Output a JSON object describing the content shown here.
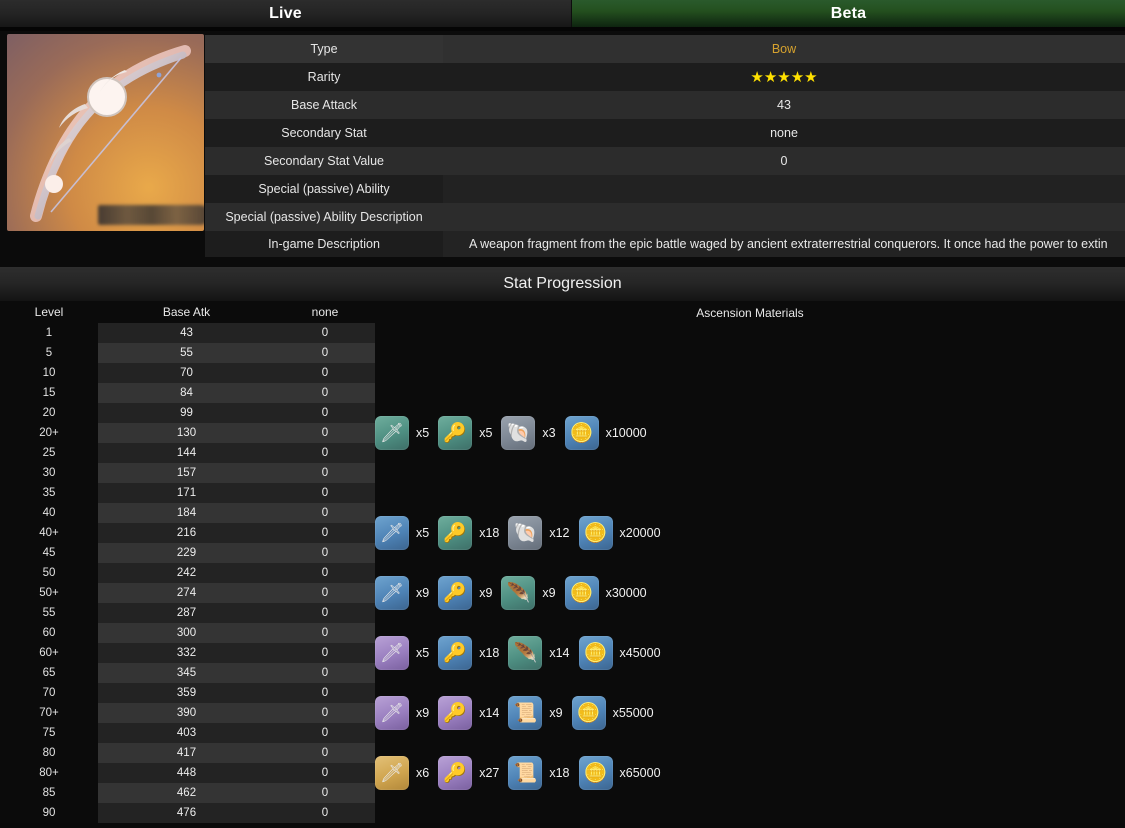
{
  "tabs": [
    {
      "label": "Live",
      "active": false
    },
    {
      "label": "Beta",
      "active": true
    }
  ],
  "weapon": {
    "thumbnail_alt": "bow-weapon-artwork",
    "name_label_blurred": ""
  },
  "info": {
    "rows": [
      {
        "key": "Type",
        "value": "Bow",
        "style": "type"
      },
      {
        "key": "Rarity",
        "value": "★★★★★",
        "style": "stars"
      },
      {
        "key": "Base Attack",
        "value": "43",
        "style": "plain"
      },
      {
        "key": "Secondary Stat",
        "value": "none",
        "style": "plain"
      },
      {
        "key": "Secondary Stat Value",
        "value": "0",
        "style": "plain"
      },
      {
        "key": "Special (passive) Ability",
        "value": "",
        "style": "plain"
      },
      {
        "key": "Special (passive) Ability Description",
        "value": "",
        "style": "plain"
      },
      {
        "key": "In-game Description",
        "value": "A weapon fragment from the epic battle waged by ancient extraterrestrial conquerors. It once had the power to extin",
        "style": "desc"
      }
    ]
  },
  "stat_progression": {
    "title": "Stat Progression",
    "columns": [
      "Level",
      "Base Atk",
      "none",
      "Ascension Materials"
    ],
    "rows": [
      {
        "level": "1",
        "atk": "43",
        "sec": "0",
        "materials": []
      },
      {
        "level": "5",
        "atk": "55",
        "sec": "0",
        "materials": []
      },
      {
        "level": "10",
        "atk": "70",
        "sec": "0",
        "materials": []
      },
      {
        "level": "15",
        "atk": "84",
        "sec": "0",
        "materials": []
      },
      {
        "level": "20",
        "atk": "99",
        "sec": "0",
        "materials": []
      },
      {
        "level": "20+",
        "atk": "130",
        "sec": "0",
        "materials": [
          {
            "icon": "weapon-ascension-fragment-icon",
            "tile": "teal",
            "glyph": "🗡",
            "count": "x5"
          },
          {
            "icon": "weapon-enhancement-ore-icon",
            "tile": "teal",
            "glyph": "🔑",
            "count": "x5"
          },
          {
            "icon": "monster-drop-shell-icon",
            "tile": "grayb",
            "glyph": "🐚",
            "count": "x3"
          },
          {
            "icon": "mora-coin-icon",
            "tile": "blue",
            "glyph": "🪙",
            "count": "x10000"
          }
        ]
      },
      {
        "level": "25",
        "atk": "144",
        "sec": "0",
        "materials": []
      },
      {
        "level": "30",
        "atk": "157",
        "sec": "0",
        "materials": []
      },
      {
        "level": "35",
        "atk": "171",
        "sec": "0",
        "materials": []
      },
      {
        "level": "40",
        "atk": "184",
        "sec": "0",
        "materials": []
      },
      {
        "level": "40+",
        "atk": "216",
        "sec": "0",
        "materials": [
          {
            "icon": "weapon-ascension-fragment-icon",
            "tile": "blue",
            "glyph": "🗡",
            "count": "x5"
          },
          {
            "icon": "weapon-enhancement-ore-icon",
            "tile": "teal",
            "glyph": "🔑",
            "count": "x18"
          },
          {
            "icon": "monster-drop-shell-icon",
            "tile": "grayb",
            "glyph": "🐚",
            "count": "x12"
          },
          {
            "icon": "mora-coin-icon",
            "tile": "blue",
            "glyph": "🪙",
            "count": "x20000"
          }
        ]
      },
      {
        "level": "45",
        "atk": "229",
        "sec": "0",
        "materials": []
      },
      {
        "level": "50",
        "atk": "242",
        "sec": "0",
        "materials": []
      },
      {
        "level": "50+",
        "atk": "274",
        "sec": "0",
        "materials": [
          {
            "icon": "weapon-ascension-fragment-icon",
            "tile": "blue",
            "glyph": "🗡",
            "count": "x9"
          },
          {
            "icon": "weapon-enhancement-ore-icon",
            "tile": "blue",
            "glyph": "🔑",
            "count": "x9"
          },
          {
            "icon": "monster-drop-feather-icon",
            "tile": "teal",
            "glyph": "🪶",
            "count": "x9"
          },
          {
            "icon": "mora-coin-icon",
            "tile": "blue",
            "glyph": "🪙",
            "count": "x30000"
          }
        ]
      },
      {
        "level": "55",
        "atk": "287",
        "sec": "0",
        "materials": []
      },
      {
        "level": "60",
        "atk": "300",
        "sec": "0",
        "materials": []
      },
      {
        "level": "60+",
        "atk": "332",
        "sec": "0",
        "materials": [
          {
            "icon": "weapon-ascension-fragment-icon",
            "tile": "violet",
            "glyph": "🗡",
            "count": "x5"
          },
          {
            "icon": "weapon-enhancement-ore-icon",
            "tile": "blue",
            "glyph": "🔑",
            "count": "x18"
          },
          {
            "icon": "monster-drop-feather-icon",
            "tile": "teal",
            "glyph": "🪶",
            "count": "x14"
          },
          {
            "icon": "mora-coin-icon",
            "tile": "blue",
            "glyph": "🪙",
            "count": "x45000"
          }
        ]
      },
      {
        "level": "65",
        "atk": "345",
        "sec": "0",
        "materials": []
      },
      {
        "level": "70",
        "atk": "359",
        "sec": "0",
        "materials": []
      },
      {
        "level": "70+",
        "atk": "390",
        "sec": "0",
        "materials": [
          {
            "icon": "weapon-ascension-fragment-icon",
            "tile": "violet",
            "glyph": "🗡",
            "count": "x9"
          },
          {
            "icon": "weapon-enhancement-ore-icon",
            "tile": "violet",
            "glyph": "🔑",
            "count": "x14"
          },
          {
            "icon": "monster-drop-scroll-icon",
            "tile": "blue",
            "glyph": "📜",
            "count": "x9"
          },
          {
            "icon": "mora-coin-icon",
            "tile": "blue",
            "glyph": "🪙",
            "count": "x55000"
          }
        ]
      },
      {
        "level": "75",
        "atk": "403",
        "sec": "0",
        "materials": []
      },
      {
        "level": "80",
        "atk": "417",
        "sec": "0",
        "materials": []
      },
      {
        "level": "80+",
        "atk": "448",
        "sec": "0",
        "materials": [
          {
            "icon": "weapon-ascension-fragment-icon",
            "tile": "gold",
            "glyph": "🗡",
            "count": "x6"
          },
          {
            "icon": "weapon-enhancement-ore-icon",
            "tile": "violet",
            "glyph": "🔑",
            "count": "x27"
          },
          {
            "icon": "monster-drop-scroll-icon",
            "tile": "blue",
            "glyph": "📜",
            "count": "x18"
          },
          {
            "icon": "mora-coin-icon",
            "tile": "blue",
            "glyph": "🪙",
            "count": "x65000"
          }
        ]
      },
      {
        "level": "85",
        "atk": "462",
        "sec": "0",
        "materials": []
      },
      {
        "level": "90",
        "atk": "476",
        "sec": "0",
        "materials": []
      }
    ]
  },
  "colors": {
    "accent_gold": "#d6a22e",
    "star_yellow": "#ffe100",
    "beta_green": "#24501f",
    "background": "#0b0b0b"
  }
}
